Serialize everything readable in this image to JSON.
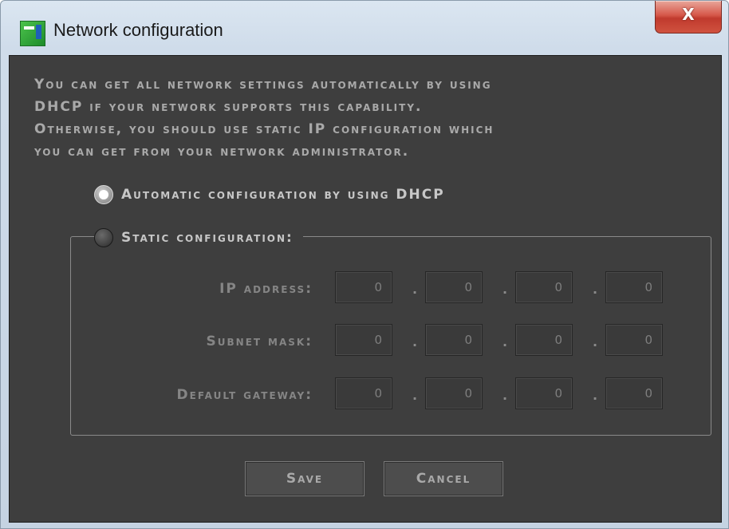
{
  "window": {
    "title": "Network configuration",
    "close_label": "X"
  },
  "description": [
    "You can get all network settings automatically by using",
    "DHCP if your network supports this capability.",
    "Otherwise, you should use static IP configuration which",
    "you can get from your network administrator."
  ],
  "options": {
    "automatic": {
      "label": "Automatic configuration by using DHCP",
      "selected": true
    },
    "static": {
      "label": "Static configuration:",
      "selected": false
    }
  },
  "fields": {
    "ip": {
      "label": "IP address:",
      "octets": [
        "0",
        "0",
        "0",
        "0"
      ]
    },
    "subnet": {
      "label": "Subnet mask:",
      "octets": [
        "0",
        "0",
        "0",
        "0"
      ]
    },
    "gateway": {
      "label": "Default gateway:",
      "octets": [
        "0",
        "0",
        "0",
        "0"
      ]
    }
  },
  "separator": ".",
  "buttons": {
    "save": "Save",
    "cancel": "Cancel"
  }
}
